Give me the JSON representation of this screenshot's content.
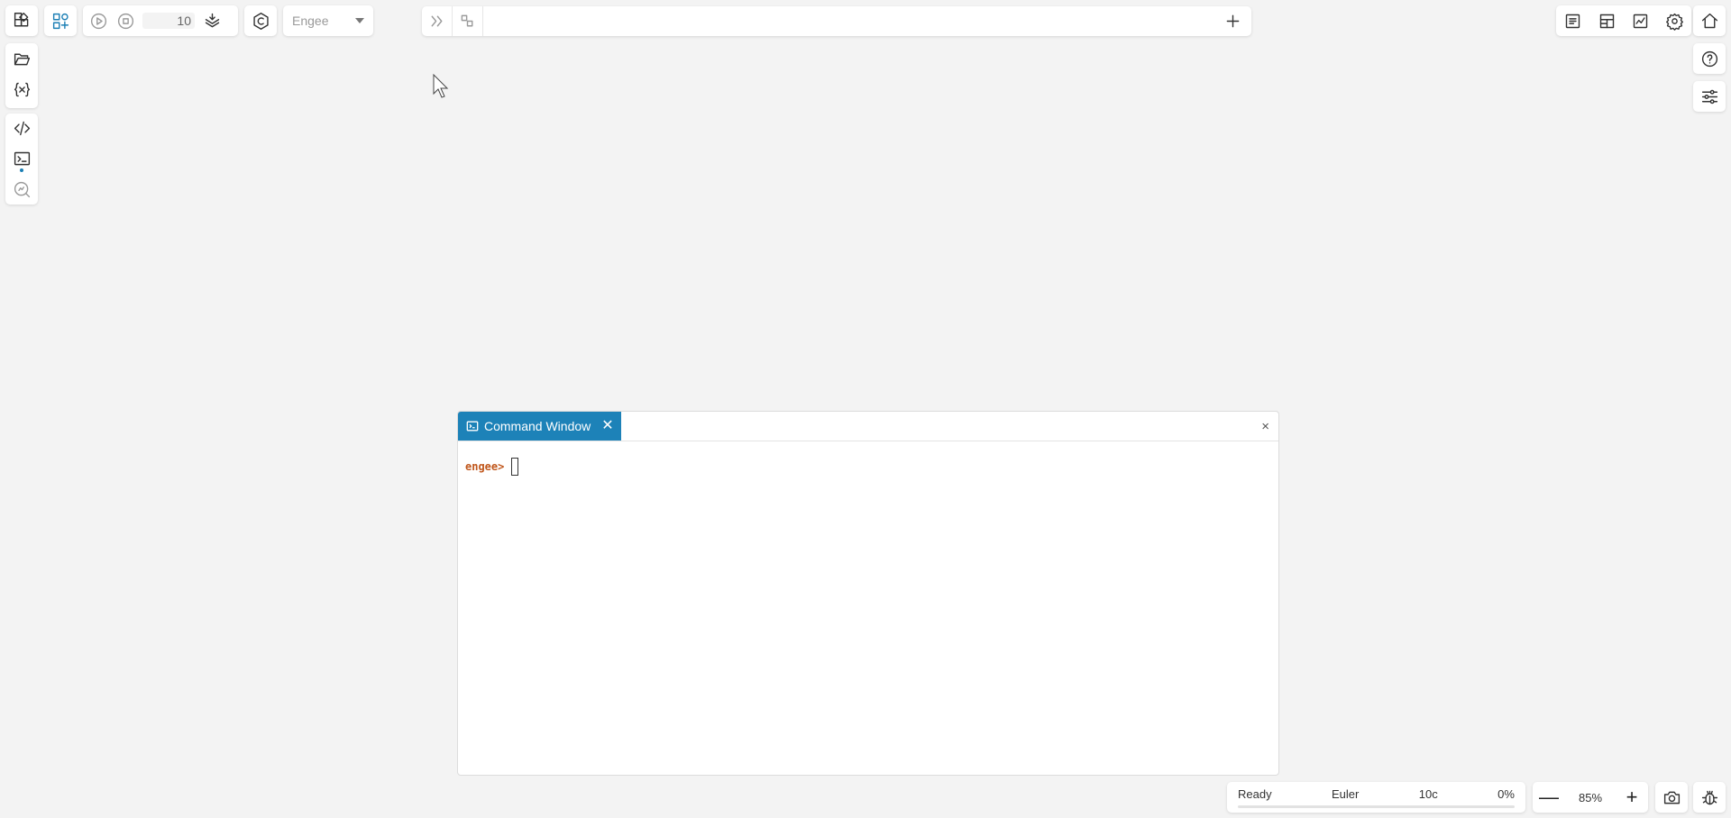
{
  "toolbar": {
    "sim_stop_time": "10",
    "solver_select": "Engee"
  },
  "command_window": {
    "tab_label": "Command Window",
    "tab_close": "✕",
    "panel_close": "×",
    "prompt": "engee>"
  },
  "status_bar": {
    "state": "Ready",
    "solver": "Euler",
    "time": "10c",
    "progress": "0%",
    "progress_value": 0
  },
  "zoom": {
    "minus": "—",
    "value": "85%",
    "plus": "+"
  },
  "accent_color": "#1d82b8",
  "prompt_color": "#c0561b"
}
